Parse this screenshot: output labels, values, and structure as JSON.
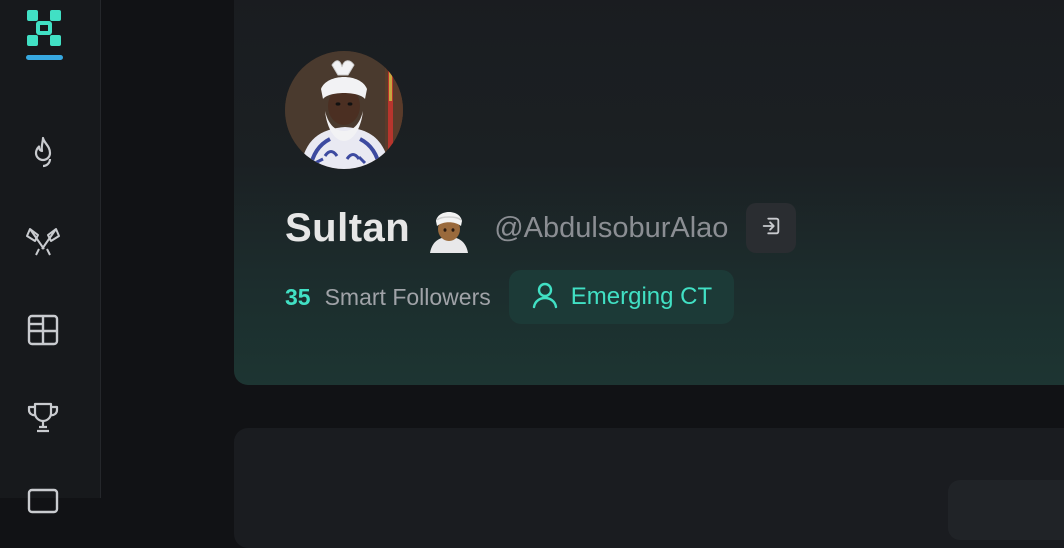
{
  "app": {
    "logo_icon": "x-brand-logo-icon",
    "accent_color": "#41e0c4"
  },
  "sidebar": {
    "items": [
      {
        "icon": "flame-icon"
      },
      {
        "icon": "crossed-flags-icon"
      },
      {
        "icon": "grid-layout-icon"
      },
      {
        "icon": "trophy-icon"
      },
      {
        "icon": "inbox-icon"
      }
    ]
  },
  "profile": {
    "display_name": "Sultan",
    "name_emoji": "person-with-turban-emoji",
    "handle": "@AbdulsoburAlao",
    "logout_icon": "sign-in-arrow-icon",
    "smart_followers_count": "35",
    "smart_followers_label": "Smart Followers",
    "tier_label": "Emerging CT",
    "tier_icon": "user-icon"
  }
}
